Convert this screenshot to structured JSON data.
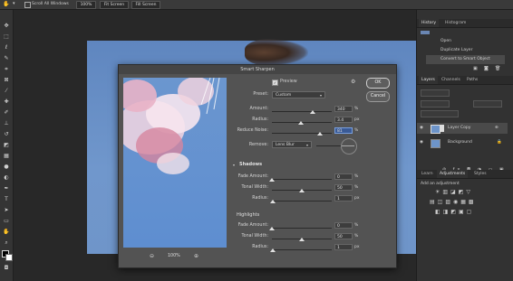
{
  "options_bar": {
    "scroll_all_windows": "Scroll All Windows",
    "zoom": "100%",
    "fit_screen": "Fit Screen",
    "fill_screen": "Fill Screen"
  },
  "history_panel": {
    "tabs": [
      "History",
      "Histogram"
    ],
    "items": [
      "Open",
      "Duplicate Layer",
      "Convert to Smart Object"
    ]
  },
  "layers_panel": {
    "tabs": [
      "Layers",
      "Channels",
      "Paths"
    ],
    "layers": [
      "Layer Copy",
      "Background"
    ]
  },
  "adjustments_panel": {
    "tabs": [
      "Learn",
      "Adjustments",
      "Styles"
    ],
    "add_label": "Add an adjustment"
  },
  "dialog": {
    "title": "Smart Sharpen",
    "preview_label": "Preview",
    "preset_label": "Preset:",
    "preset_value": "Custom",
    "ok": "OK",
    "cancel": "Cancel",
    "zoom": "100%",
    "main": [
      {
        "label": "Amount:",
        "value": "340",
        "unit": "%",
        "level": 0.68
      },
      {
        "label": "Radius:",
        "value": "3.4",
        "unit": "px",
        "level": 0.48
      },
      {
        "label": "Reduce Noise:",
        "value": "81",
        "unit": "%",
        "level": 0.81
      }
    ],
    "remove_label": "Remove:",
    "remove_value": "Lens Blur",
    "shadows": {
      "title": "Shadows",
      "rows": [
        {
          "label": "Fade Amount:",
          "value": "0",
          "unit": "%",
          "level": 0.0
        },
        {
          "label": "Tonal Width:",
          "value": "50",
          "unit": "%",
          "level": 0.5
        },
        {
          "label": "Radius:",
          "value": "1",
          "unit": "px",
          "level": 0.01
        }
      ]
    },
    "highlights": {
      "title": "Highlights",
      "rows": [
        {
          "label": "Fade Amount:",
          "value": "0",
          "unit": "%",
          "level": 0.0
        },
        {
          "label": "Tonal Width:",
          "value": "50",
          "unit": "%",
          "level": 0.5
        },
        {
          "label": "Radius:",
          "value": "1",
          "unit": "px",
          "level": 0.01
        }
      ]
    }
  }
}
